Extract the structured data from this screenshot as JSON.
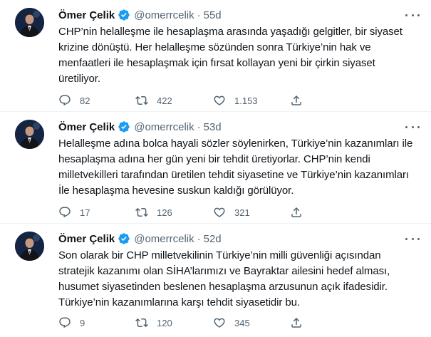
{
  "tweets": [
    {
      "name": "Ömer Çelik",
      "handle": "@omerrcelik",
      "dot": "·",
      "time": "55d",
      "text": "CHP’nin helalleşme ile hesaplaşma arasında yaşadığı gelgitler, bir siyaset\nkrizine dönüştü. Her helalleşme sözünden sonra Türkiye’nin hak ve\nmenfaatleri ile hesaplaşmak için fırsat kollayan yeni bir çirkin siyaset\nüretiliyor.",
      "replies": "82",
      "retweets": "422",
      "likes": "1.153"
    },
    {
      "name": "Ömer Çelik",
      "handle": "@omerrcelik",
      "dot": "·",
      "time": "53d",
      "text": "Helalleşme adına bolca hayali sözler söylenirken, Türkiye’nin kazanımları ile\nhesaplaşma adına her gün yeni bir tehdit üretiyorlar. CHP’nin kendi\nmilletvekilleri tarafından üretilen tehdit siyasetine ve Türkiye’nin kazanımları\nİle hesaplaşma hevesine suskun kaldığı görülüyor.",
      "replies": "17",
      "retweets": "126",
      "likes": "321"
    },
    {
      "name": "Ömer Çelik",
      "handle": "@omerrcelik",
      "dot": "·",
      "time": "52d",
      "text": "Son olarak bir CHP milletvekilinin Türkiye’nin milli güvenliği açısından\nstratejik kazanımı olan SİHA’larımızı ve Bayraktar ailesini hedef alması,\nhusumet siyasetinden beslenen hesaplaşma arzusunun açık ifadesidir.\nTürkiye’nin kazanımlarına karşı tehdit siyasetidir bu.",
      "replies": "9",
      "retweets": "120",
      "likes": "345"
    }
  ],
  "colors": {
    "verified": "#1d9bf0",
    "secondary_text": "#536471",
    "primary_text": "#0f1419"
  },
  "icons": [
    "avatar-photo",
    "verified-badge-icon",
    "more-options-icon",
    "reply-icon",
    "retweet-icon",
    "like-icon",
    "share-icon"
  ]
}
